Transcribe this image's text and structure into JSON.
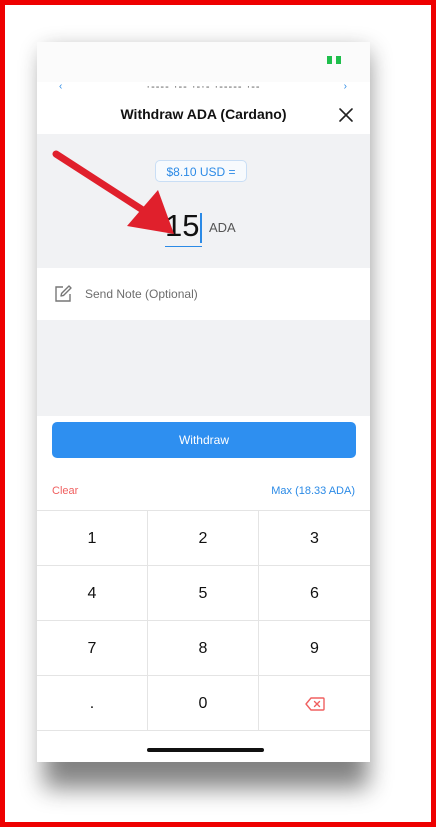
{
  "header": {
    "title": "Withdraw ADA (Cardano)"
  },
  "amount": {
    "usd_equivalent": "$8.10 USD =",
    "value": "15",
    "unit": "ADA"
  },
  "note": {
    "placeholder": "Send Note (Optional)"
  },
  "withdraw_label": "Withdraw",
  "actions": {
    "clear_label": "Clear",
    "max_label": "Max (18.33 ADA)"
  },
  "keypad": {
    "keys": [
      "1",
      "2",
      "3",
      "4",
      "5",
      "6",
      "7",
      "8",
      "9",
      ".",
      "0"
    ],
    "backspace_icon": "backspace-icon"
  },
  "colors": {
    "accent": "#2e8ff0",
    "clear": "#f06060",
    "annotation_arrow": "#e0202c",
    "frame_border": "#ee0000",
    "status_green": "#1fbf4c"
  }
}
